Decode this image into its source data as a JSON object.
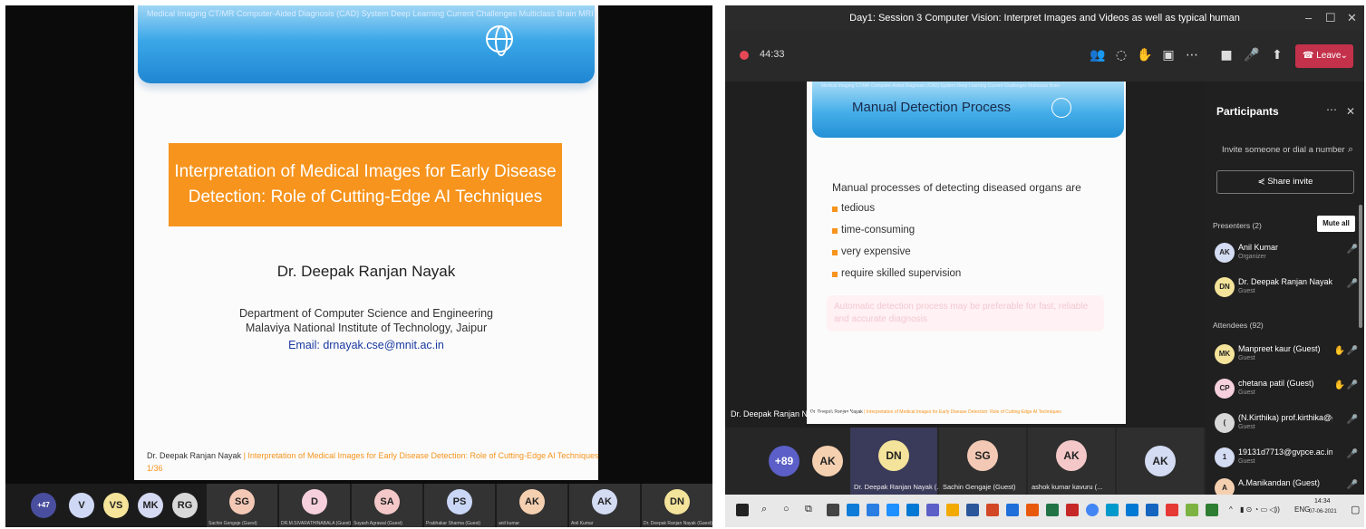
{
  "left": {
    "slide": {
      "nav": "Medical Imaging    CT/MR    Computer-Aided Diagnosis (CAD) System   Deep Learning   Current Challenges   Multiclass Brain MRI",
      "title_line1": "Interpretation of Medical Images for Early Disease",
      "title_line2": "Detection: Role of Cutting-Edge AI Techniques",
      "author": "Dr. Deepak Ranjan Nayak",
      "dept": "Department of Computer Science and Engineering",
      "inst": "Malaviya National Institute of Technology, Jaipur",
      "email_label": "Email:",
      "email": "drnayak.cse@mnit.ac.in",
      "footer_author": "Dr. Deepak Ranjan Nayak",
      "footer_title": "| Interpretation of Medical Images for Early Disease Detection: Role of Cutting-Edge AI Techniques",
      "page": "1/36"
    },
    "strip": {
      "more": "+47",
      "avatars": [
        {
          "initials": "V",
          "color": "#cfd8f5"
        },
        {
          "initials": "VS",
          "color": "#f6e49a"
        },
        {
          "initials": "MK",
          "color": "#d5d9f2"
        },
        {
          "initials": "RG",
          "color": "#d8d8d8"
        }
      ],
      "tiles": [
        {
          "initials": "SG",
          "name": "Sachin Gengaje (Guest)",
          "color": "#f3c9b5"
        },
        {
          "initials": "D",
          "name": "DR.M.SIVARATHINABALA (Guest)",
          "color": "#f6d0dc"
        },
        {
          "initials": "SA",
          "name": "Suyash Agrawal (Guest)",
          "color": "#f4c8c8"
        },
        {
          "initials": "PS",
          "name": "Prabhakar Sharma (Guest)",
          "color": "#c9d6f6"
        },
        {
          "initials": "AK",
          "name": "anil kumar",
          "color": "#f5d0b0"
        },
        {
          "initials": "AK",
          "name": "Anil Kumar",
          "color": "#d4dcf4"
        },
        {
          "initials": "DN",
          "name": "Dr. Deepak Ranjan Nayak (Guest)",
          "color": "#f4e39a"
        }
      ]
    }
  },
  "right": {
    "window_title": "Day1: Session 3 Computer Vision: Interpret Images and Videos as well as typical human",
    "timer": "44:33",
    "leave_label": "Leave",
    "slide": {
      "nav": "Medical Imaging   CT/MR   Computer-Aided Diagnosis (CAD) System   Deep Learning   Current Challenges   Multiclass Brain",
      "title": "Manual Detection Process",
      "intro": "Manual processes of detecting diseased organs are",
      "bullets": [
        "tedious",
        "time-consuming",
        "very expensive",
        "require skilled supervision"
      ],
      "ghost": "Automatic detection process may be preferable for fast, reliable and accurate diagnosis",
      "footer_author": "Dr. Deepak Ranjan Nayak",
      "footer_title": "| Interpretation of Medical Images for Early Disease Detection: Role of Cutting-Edge AI Techniques",
      "speaker": "Dr. Deepak Ranjan Nayak (Guest)"
    },
    "videos": [
      {
        "initials": "+89",
        "name": "",
        "color": "#5b5fc7"
      },
      {
        "initials": "AK",
        "name": "",
        "color": "#f5d0b0"
      },
      {
        "initials": "DN",
        "name": "Dr. Deepak Ranjan Nayak (...",
        "color": "#f4e39a"
      },
      {
        "initials": "SG",
        "name": "Sachin Gengaje (Guest)",
        "color": "#f3c9b5"
      },
      {
        "initials": "AK",
        "name": "ashok kumar kavuru (...",
        "color": "#f4c8c8"
      },
      {
        "initials": "AK",
        "name": "",
        "color": "#d4dcf4"
      }
    ],
    "panel": {
      "title": "Participants",
      "invite_placeholder": "Invite someone or dial a number",
      "share_label": "Share invite",
      "presenters_label": "Presenters (2)",
      "mute_all": "Mute all",
      "attendees_label": "Attendees (92)",
      "presenters": [
        {
          "initials": "AK",
          "name": "Anil Kumar",
          "role": "Organizer",
          "color": "#d4dcf4"
        },
        {
          "initials": "DN",
          "name": "Dr. Deepak Ranjan Nayak (G...",
          "role": "Guest",
          "color": "#f4e39a"
        }
      ],
      "attendees": [
        {
          "initials": "MK",
          "name": "Manpreet kaur (Guest)",
          "role": "Guest",
          "color": "#f4e39a",
          "hand": true
        },
        {
          "initials": "CP",
          "name": "chetana patil (Guest)",
          "role": "Guest",
          "color": "#f6d0dc",
          "hand": true
        },
        {
          "initials": "(",
          "name": "(N.Kirthika) prof.kirthika@gm...",
          "role": "Guest",
          "color": "#d8d8d8",
          "hand": false
        },
        {
          "initials": "1",
          "name": "19131d7713@gvpce.ac.in (Gu...",
          "role": "Guest",
          "color": "#d4dcf4",
          "hand": false
        },
        {
          "initials": "A",
          "name": "A.Manikandan (Guest)",
          "role": "Guest",
          "color": "#f5d0b0",
          "hand": false
        }
      ]
    },
    "taskbar": {
      "lang": "ENG",
      "time": "14:34",
      "date": "07-06-2021"
    }
  }
}
